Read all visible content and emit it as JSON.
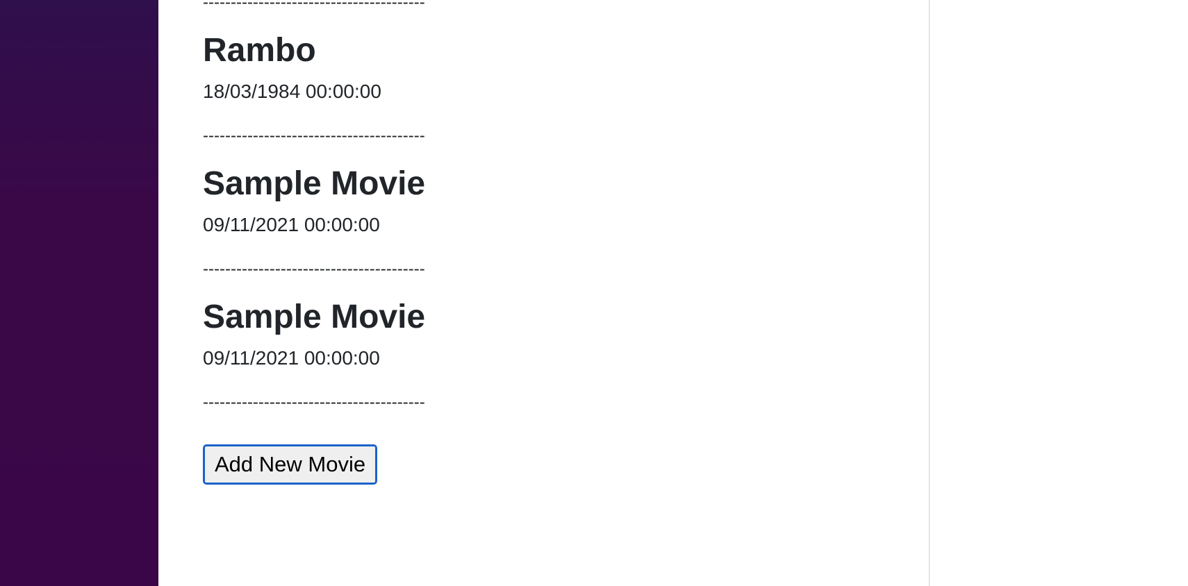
{
  "movies": [
    {
      "title": "Rambo",
      "date": "18/03/1984 00:00:00"
    },
    {
      "title": "Sample Movie",
      "date": "09/11/2021 00:00:00"
    },
    {
      "title": "Sample Movie",
      "date": "09/11/2021 00:00:00"
    }
  ],
  "separator_text": "----------------------------------------",
  "actions": {
    "add_movie_label": "Add New Movie"
  },
  "colors": {
    "sidebar_top": "#2f0f4c",
    "sidebar_bottom": "#3a0647",
    "button_border": "#1a62c9"
  }
}
